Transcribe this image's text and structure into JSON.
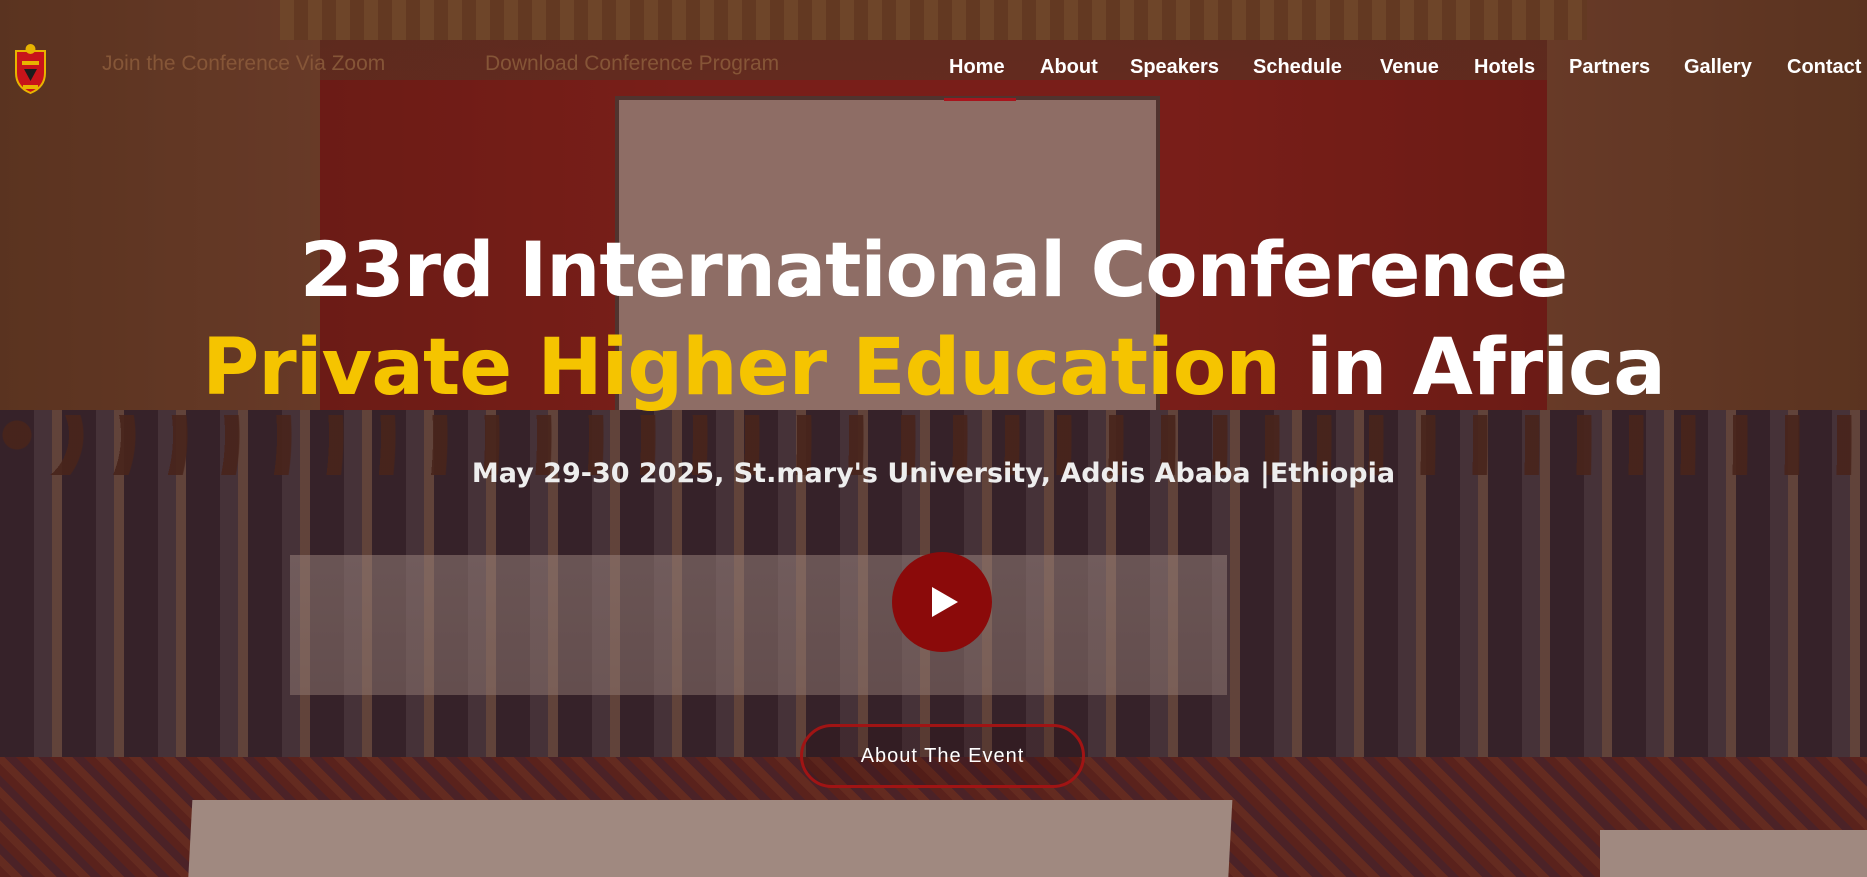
{
  "header": {
    "logo_icon": "university-crest-icon",
    "zoom_link": "Join the Conference Via Zoom",
    "program_link": "Download Conference Program",
    "nav": [
      {
        "label": "Home",
        "active": true
      },
      {
        "label": "About"
      },
      {
        "label": "Speakers"
      },
      {
        "label": "Schedule"
      },
      {
        "label": "Venue"
      },
      {
        "label": "Hotels"
      },
      {
        "label": "Partners"
      },
      {
        "label": "Gallery"
      },
      {
        "label": "Contact"
      }
    ]
  },
  "hero": {
    "title_line1": "23rd International Conference",
    "title_line2_accent": "Private Higher Education",
    "title_line2_rest": " in Africa",
    "subtitle": "May 29-30 2025, St.mary's University, Addis Ababa |Ethiopia",
    "play_icon": "play-icon",
    "cta_label": "About The Event"
  },
  "colors": {
    "accent_yellow": "#f5c400",
    "brand_red": "#8b0a0a",
    "active_underline": "#a8141c",
    "text_white": "#ffffff"
  }
}
